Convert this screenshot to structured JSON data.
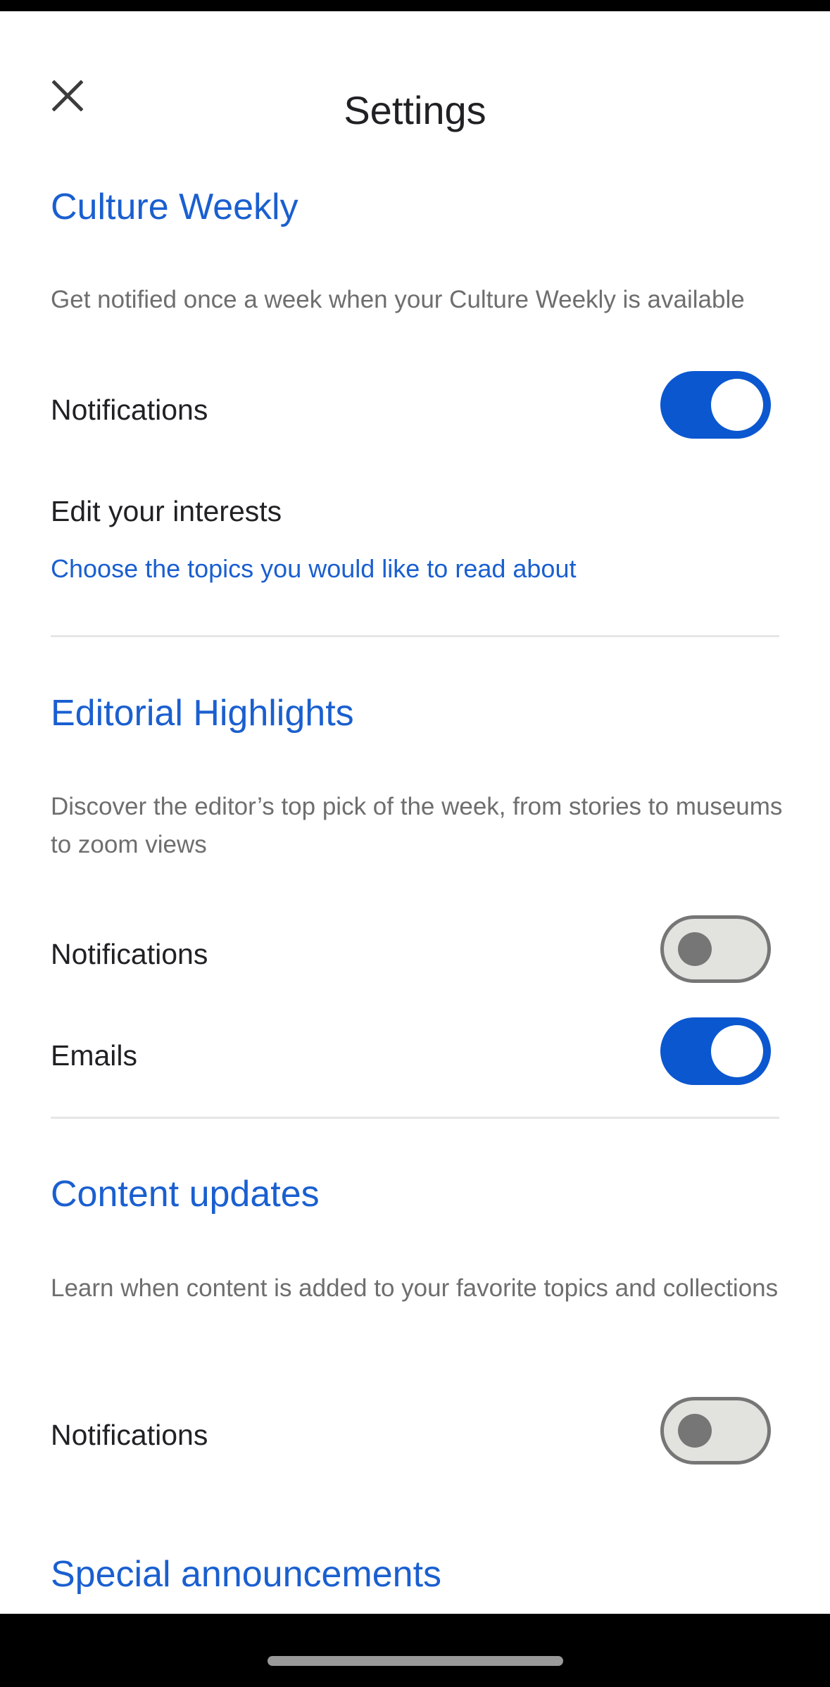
{
  "app_bar": {
    "title": "Settings",
    "close_icon": "close-icon"
  },
  "sections": [
    {
      "title": "Culture Weekly",
      "description": "Get notified once a week when your Culture Weekly is available",
      "settings": [
        {
          "label": "Notifications",
          "enabled": true
        }
      ],
      "interests": {
        "title": "Edit your interests",
        "link": "Choose the topics you would like to read about"
      }
    },
    {
      "title": "Editorial Highlights",
      "description": "Discover the editor’s top pick of the week, from stories to museums to zoom views",
      "settings": [
        {
          "label": "Notifications",
          "enabled": false
        },
        {
          "label": "Emails",
          "enabled": true
        }
      ]
    },
    {
      "title": "Content updates",
      "description": "Learn when content is added to your favorite topics and collections",
      "settings": [
        {
          "label": "Notifications",
          "enabled": false
        }
      ]
    },
    {
      "title": "Special announcements"
    }
  ],
  "colors": {
    "accent": "#0b57d0",
    "link": "#1a5fd0",
    "toggle_off_track": "#e2e3df",
    "toggle_off_knob": "#767676"
  }
}
